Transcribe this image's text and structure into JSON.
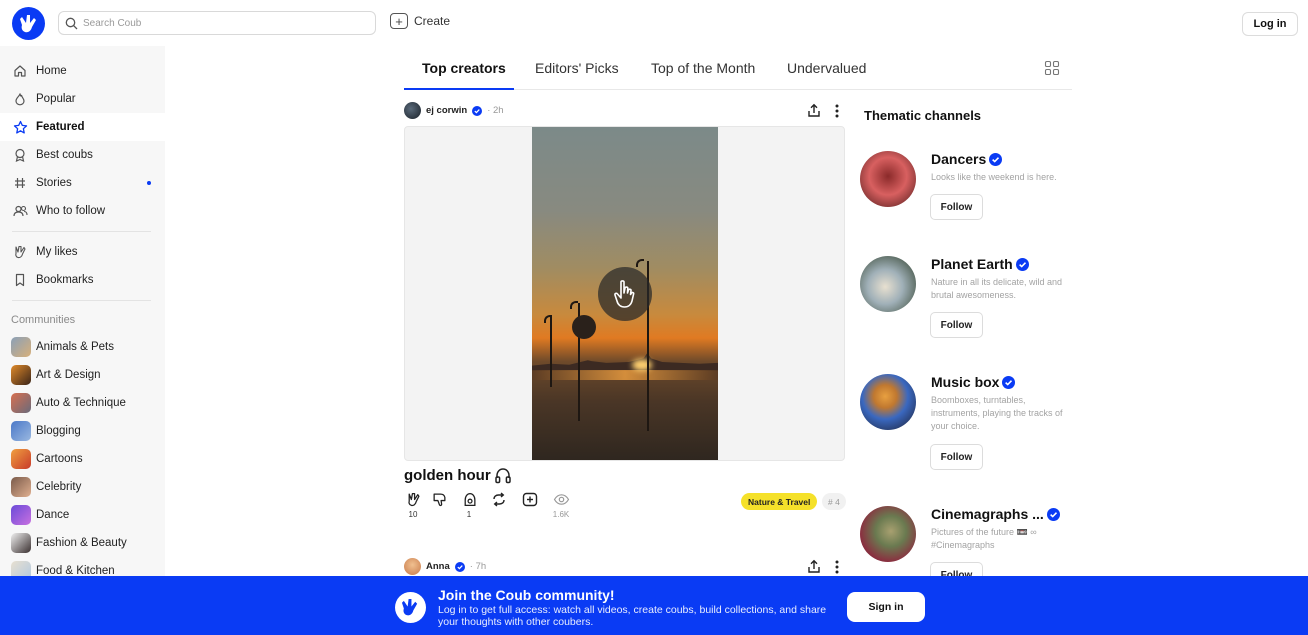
{
  "brand": {
    "accent": "#0a3bf4",
    "tag_color": "#f5e12a"
  },
  "header": {
    "search_placeholder": "Search Coub",
    "create_label": "Create",
    "login_label": "Log in"
  },
  "sidebar": {
    "nav": [
      {
        "label": "Home",
        "icon": "home-icon"
      },
      {
        "label": "Popular",
        "icon": "flame-icon"
      },
      {
        "label": "Featured",
        "icon": "star-icon",
        "active": true
      },
      {
        "label": "Best coubs",
        "icon": "award-icon"
      },
      {
        "label": "Stories",
        "icon": "stories-icon",
        "dot": true
      },
      {
        "label": "Who to follow",
        "icon": "users-icon"
      }
    ],
    "personal": [
      {
        "label": "My likes",
        "icon": "like-icon"
      },
      {
        "label": "Bookmarks",
        "icon": "bookmark-icon"
      }
    ],
    "communities_label": "Communities",
    "communities": [
      "Animals & Pets",
      "Art & Design",
      "Auto & Technique",
      "Blogging",
      "Cartoons",
      "Celebrity",
      "Dance",
      "Fashion & Beauty",
      "Food & Kitchen"
    ]
  },
  "tabs": [
    "Top creators",
    "Editors' Picks",
    "Top of the Month",
    "Undervalued"
  ],
  "post": {
    "author": "ej corwin",
    "time": "2h",
    "title": "golden hour",
    "likes": "10",
    "recoubs": "1",
    "views": "1.6K",
    "tag": "Nature & Travel",
    "tag_count": "# 4"
  },
  "post2": {
    "author": "Anna",
    "time": "7h"
  },
  "right": {
    "title": "Thematic channels",
    "follow_label": "Follow",
    "channels": [
      {
        "name": "Dancers",
        "desc": "Looks like the weekend is here."
      },
      {
        "name": "Planet Earth",
        "desc": "Nature in all its delicate, wild and brutal awesomeness."
      },
      {
        "name": "Music box",
        "desc": "Boomboxes, turntables, instruments, playing the tracks of your choice."
      },
      {
        "name": "Cinemagraphs ...",
        "desc": "Pictures of the future 📼 ∞ #Cinemagraphs"
      }
    ]
  },
  "banner": {
    "title": "Join the Coub community!",
    "text": "Log in to get full access: watch all videos, create coubs, build collections, and share your thoughts with other coubers.",
    "signin_label": "Sign in"
  }
}
